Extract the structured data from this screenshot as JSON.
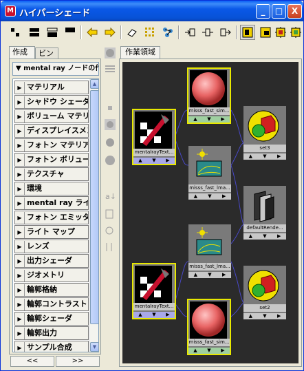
{
  "window": {
    "title": "ハイパーシェード",
    "app_icon": "maya-icon"
  },
  "title_buttons": {
    "minimize": "_",
    "maximize": "□",
    "close": "X"
  },
  "left_tabs": [
    "作成",
    "ビン"
  ],
  "dropdown": {
    "label": "▼ mental ray ノードの作成"
  },
  "categories": [
    "マテリアル",
    "シャドウ シェーダ",
    "ボリューム マテリアル",
    "ディスプレイスメント",
    "フォトン マテリアル",
    "フォトン ボリューム",
    "テクスチャ",
    "環境",
    "mental ray ライト",
    "フォトン エミッタ",
    "ライト マップ",
    "レンズ",
    "出力シェーダ",
    "ジオメトリ",
    "輪郭格納",
    "輪郭コントラスト",
    "輪郭シェーダ",
    "輪郭出力",
    "サンプル合成"
  ],
  "nav": {
    "prev": "<<",
    "next": ">>"
  },
  "work_tab": "作業領域",
  "nodes": {
    "shader_top": {
      "label": "misss_fast_sim..."
    },
    "texture_top": {
      "label": "mentalrayText..."
    },
    "set_top": {
      "label": "set3"
    },
    "lightmap_top": {
      "label": "misss_fast_lma..."
    },
    "default_render": {
      "label": "defaultRende..."
    },
    "lightmap_bottom": {
      "label": "misss_fast_lma..."
    },
    "texture_bottom": {
      "label": "mentalrayText..."
    },
    "set_bottom": {
      "label": "set2"
    },
    "shader_bottom": {
      "label": "misss_fast_sim..."
    }
  },
  "colors": {
    "selection": "#e8e800",
    "canvas": "#2b2b2b",
    "connection": "#4848c8"
  }
}
